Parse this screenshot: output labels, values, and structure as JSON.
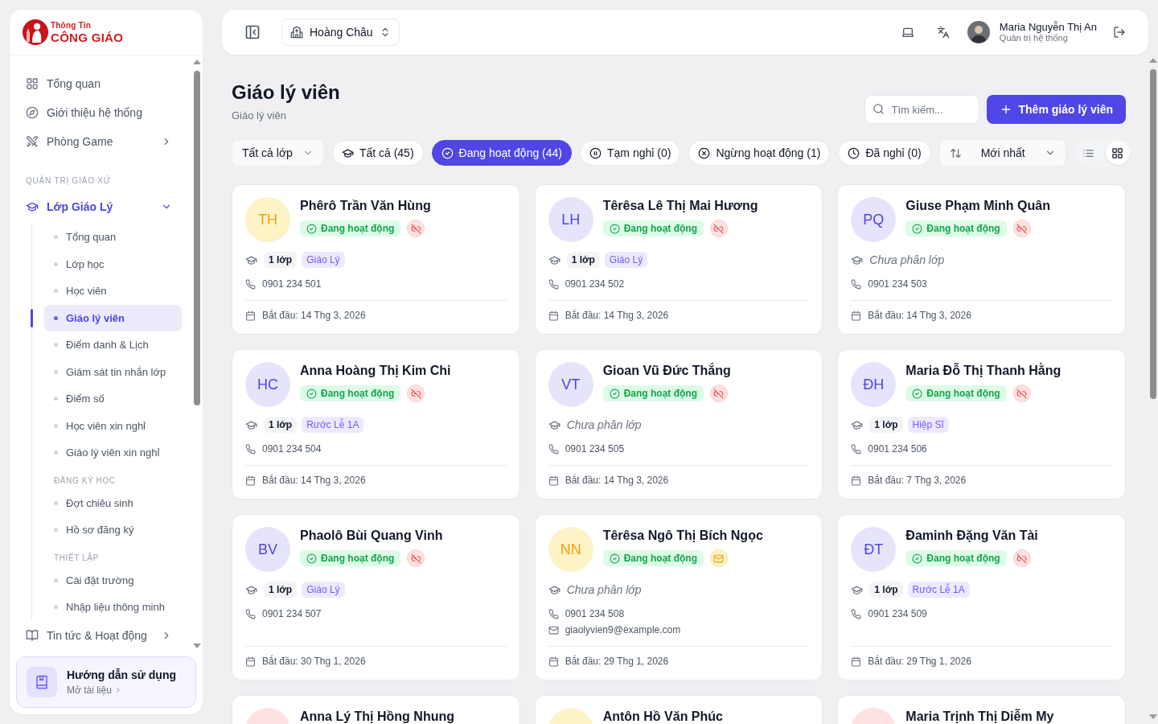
{
  "sidebar": {
    "logo": {
      "top": "Thông Tin",
      "bottom": "CÔNG GIÁO"
    },
    "items": [
      {
        "kind": "link",
        "label": "Tổng quan",
        "active": false
      },
      {
        "kind": "link",
        "label": "Giới thiệu hệ thống",
        "active": false
      },
      {
        "kind": "link",
        "label": "Phòng Game",
        "active": false,
        "expanded": false
      },
      {
        "kind": "heading",
        "label": "QUẢN TRỊ GIÁO XỨ"
      },
      {
        "kind": "link",
        "label": "Lớp Giáo Lý",
        "active": true,
        "expanded": true,
        "children": [
          {
            "kind": "link",
            "label": "Tổng quan",
            "selected": false
          },
          {
            "kind": "link",
            "label": "Lớp học",
            "selected": false
          },
          {
            "kind": "link",
            "label": "Học viên",
            "selected": false
          },
          {
            "kind": "link",
            "label": "Giáo lý viên",
            "selected": true
          },
          {
            "kind": "link",
            "label": "Điểm danh & Lịch",
            "selected": false
          },
          {
            "kind": "link",
            "label": "Giám sát tin nhắn lớp",
            "selected": false
          },
          {
            "kind": "link",
            "label": "Điểm số",
            "selected": false
          },
          {
            "kind": "link",
            "label": "Học viên xin nghỉ",
            "selected": false
          },
          {
            "kind": "link",
            "label": "Giáo lý viên xin nghỉ",
            "selected": false
          },
          {
            "kind": "heading",
            "label": "ĐĂNG KÝ HỌC"
          },
          {
            "kind": "link",
            "label": "Đợt chiêu sinh",
            "selected": false
          },
          {
            "kind": "link",
            "label": "Hồ sơ đăng ký",
            "selected": false
          },
          {
            "kind": "heading",
            "label": "THIẾT LẬP"
          },
          {
            "kind": "link",
            "label": "Cài đặt trường",
            "selected": false
          },
          {
            "kind": "link",
            "label": "Nhập liệu thông minh",
            "selected": false
          }
        ]
      },
      {
        "kind": "link",
        "label": "Tin tức & Hoạt động",
        "active": false,
        "expanded": false
      }
    ],
    "guide": {
      "title": "Hướng dẫn sử dụng",
      "link": "Mở tài liệu"
    }
  },
  "topbar": {
    "parish": "Hoàng Châu",
    "user": {
      "name": "Maria Nguyễn Thị An",
      "role": "Quản trị hệ thống"
    }
  },
  "header": {
    "title": "Giáo lý viên",
    "subtitle": "Giáo lý viên",
    "search": {
      "placeholder": "Tìm kiếm..."
    },
    "add_button": "Thêm giáo lý viên"
  },
  "filters": {
    "class_select": "Tất cả lớp",
    "statuses": [
      {
        "label": "Tất cả (45)",
        "selected": false
      },
      {
        "label": "Đang hoạt động (44)",
        "selected": true
      },
      {
        "label": "Tạm nghỉ (0)",
        "selected": false
      },
      {
        "label": "Ngừng hoạt động (1)",
        "selected": false
      },
      {
        "label": "Đã nghỉ (0)",
        "selected": false
      }
    ],
    "sort": "Mới nhất",
    "views": [
      {
        "kind": "list",
        "selected": false
      },
      {
        "kind": "grid",
        "selected": true
      }
    ]
  },
  "cards": [
    {
      "initials": "TH",
      "color": "#fef3c7",
      "name": "Phêrô Trần Văn Hùng",
      "status": "Đang hoạt động",
      "kind": "unlinked",
      "class_count": "1 lớp",
      "class_name": "Giáo Lý",
      "phone": "0901 234 501",
      "start": "Bắt đầu: 14 Thg 3, 2026"
    },
    {
      "initials": "LH",
      "color": "#e6e4fb",
      "name": "Têrêsa Lê Thị Mai Hương",
      "status": "Đang hoạt động",
      "kind": "unlinked",
      "class_count": "1 lớp",
      "class_name": "Giáo Lý",
      "phone": "0901 234 502",
      "start": "Bắt đầu: 14 Thg 3, 2026"
    },
    {
      "initials": "PQ",
      "color": "#e6e4fb",
      "name": "Giuse Phạm Minh Quân",
      "status": "Đang hoạt động",
      "kind": "unlinked",
      "class_note": "Chưa phân lớp",
      "phone": "0901 234 503",
      "start": "Bắt đầu: 14 Thg 3, 2026"
    },
    {
      "initials": "HC",
      "color": "#e6e4fb",
      "name": "Anna Hoàng Thị Kim Chi",
      "status": "Đang hoạt động",
      "kind": "unlinked",
      "class_count": "1 lớp",
      "class_name": "Rước Lễ 1A",
      "phone": "0901 234 504",
      "start": "Bắt đầu: 14 Thg 3, 2026"
    },
    {
      "initials": "VT",
      "color": "#e6e4fb",
      "name": "Gioan Vũ Đức Thắng",
      "status": "Đang hoạt động",
      "kind": "unlinked",
      "class_note": "Chưa phân lớp",
      "phone": "0901 234 505",
      "start": "Bắt đầu: 14 Thg 3, 2026"
    },
    {
      "initials": "ĐH",
      "color": "#e6e4fb",
      "name": "Maria Đỗ Thị Thanh Hằng",
      "status": "Đang hoạt động",
      "kind": "unlinked",
      "class_count": "1 lớp",
      "class_name": "Hiệp Sĩ",
      "phone": "0901 234 506",
      "start": "Bắt đầu: 7 Thg 3, 2026"
    },
    {
      "initials": "BV",
      "color": "#e6e4fb",
      "name": "Phaolô Bùi Quang Vinh",
      "status": "Đang hoạt động",
      "kind": "unlinked",
      "class_count": "1 lớp",
      "class_name": "Giáo Lý",
      "phone": "0901 234 507",
      "start": "Bắt đầu: 30 Thg 1, 2026"
    },
    {
      "initials": "NN",
      "color": "#fef3c7",
      "name": "Têrêsa Ngô Thị Bích Ngọc",
      "status": "Đang hoạt động",
      "kind": "mail",
      "class_note": "Chưa phân lớp",
      "phone": "0901 234 508",
      "email": "giaolyvien9@example.com",
      "start": "Bắt đầu: 29 Thg 1, 2026"
    },
    {
      "initials": "ĐT",
      "color": "#e6e4fb",
      "name": "Đaminh Đặng Văn Tài",
      "status": "Đang hoạt động",
      "kind": "unlinked",
      "class_count": "1 lớp",
      "class_name": "Rước Lễ 1A",
      "phone": "0901 234 509",
      "start": "Bắt đầu: 29 Thg 1, 2026"
    },
    {
      "color": "#fee2e2",
      "name": "Anna Lý Thị Hồng Nhung"
    },
    {
      "color": "#fef3c7",
      "name": "Antôn Hồ Văn Phúc"
    },
    {
      "color": "#fee2e2",
      "name": "Maria Trịnh Thị Diễm My"
    }
  ]
}
